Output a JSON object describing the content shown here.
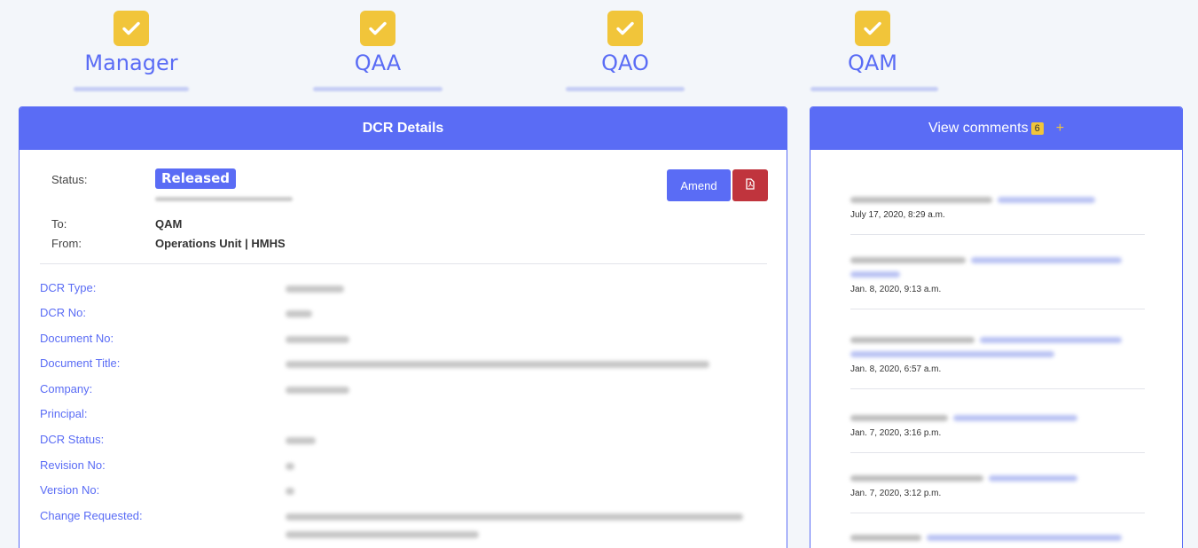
{
  "steps": [
    {
      "label": "Manager",
      "icon": "check-icon"
    },
    {
      "label": "QAA",
      "icon": "check-icon"
    },
    {
      "label": "QAO",
      "icon": "check-icon"
    },
    {
      "label": "QAM",
      "icon": "check-icon"
    }
  ],
  "details": {
    "title": "DCR Details",
    "status_label": "Status:",
    "status_value": "Released",
    "to_label": "To:",
    "to_value": "QAM",
    "from_label": "From:",
    "from_value": "Operations Unit | HMHS",
    "amend_label": "Amend",
    "pdf_icon": "pdf-icon",
    "fields": [
      "DCR Type:",
      "DCR No:",
      "Document No:",
      "Document Title:",
      "Company:",
      "Principal:",
      "DCR Status:",
      "Revision No:",
      "Version No:",
      "Change Requested:"
    ]
  },
  "comments": {
    "title": "View comments",
    "count": "6",
    "add_symbol": "+",
    "dates": [
      "July 17, 2020, 8:29 a.m.",
      "Jan. 8, 2020, 9:13 a.m.",
      "Jan. 8, 2020, 6:57 a.m.",
      "Jan. 7, 2020, 3:16 p.m.",
      "Jan. 7, 2020, 3:12 p.m."
    ]
  },
  "colors": {
    "accent": "#5a6cf5",
    "check": "#f1c53a",
    "danger": "#c0343d"
  }
}
